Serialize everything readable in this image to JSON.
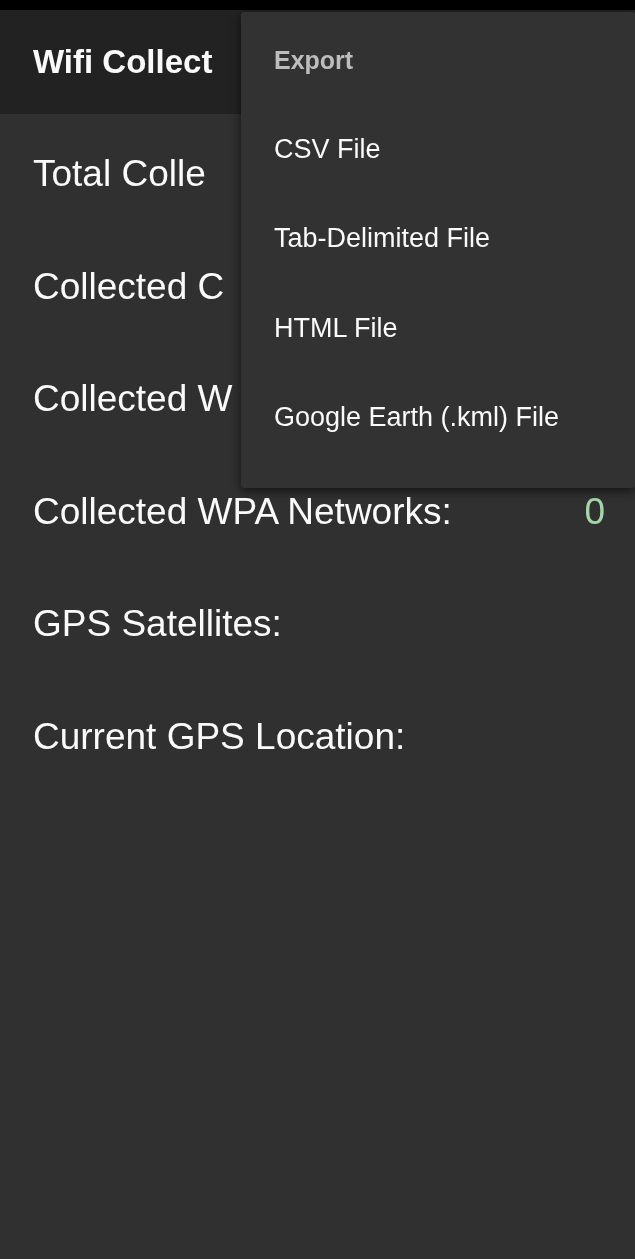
{
  "app_bar": {
    "title": "Wifi Collect"
  },
  "stats": [
    {
      "label": "Total Colle"
    },
    {
      "label": "Collected C"
    },
    {
      "label": "Collected W"
    },
    {
      "label": "Collected WPA Networks:",
      "value": "0"
    },
    {
      "label": "GPS Satellites:"
    },
    {
      "label": "Current GPS Location:"
    }
  ],
  "menu": {
    "header": "Export",
    "items": [
      "CSV File",
      "Tab-Delimited File",
      "HTML File",
      "Google Earth (.kml) File"
    ]
  }
}
